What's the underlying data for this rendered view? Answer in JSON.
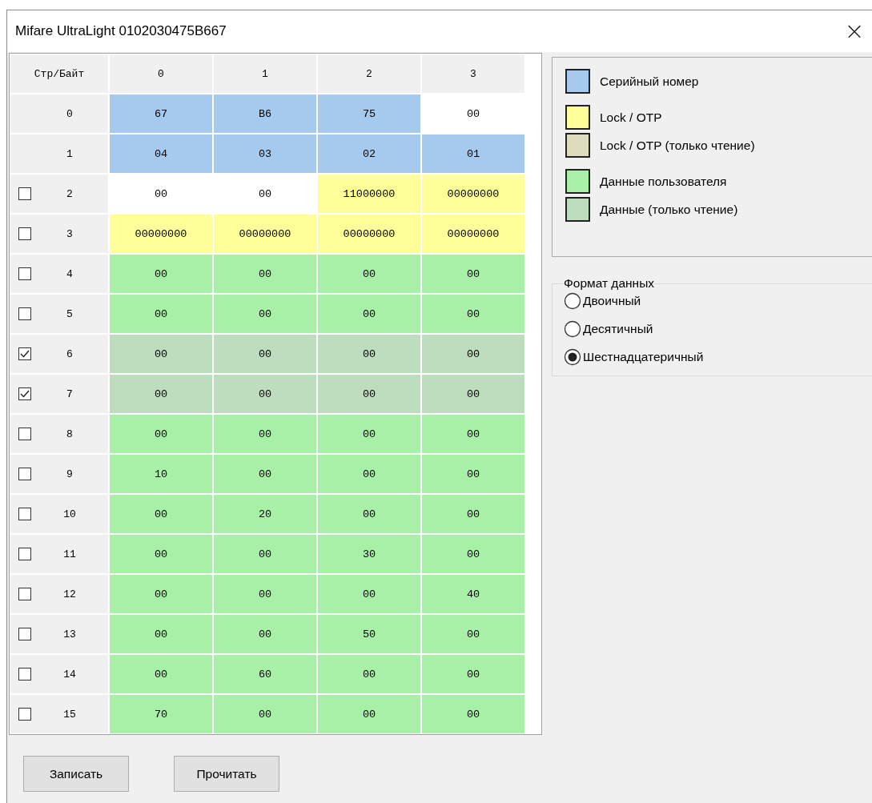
{
  "window": {
    "title": "Mifare UltraLight 0102030475B667",
    "close": "×"
  },
  "table": {
    "corner": "Стр/Байт",
    "columns": [
      "0",
      "1",
      "2",
      "3"
    ],
    "rows": [
      {
        "page": "0",
        "cells": [
          {
            "value": "67",
            "kind": "serial"
          },
          {
            "value": "B6",
            "kind": "serial"
          },
          {
            "value": "75",
            "kind": "serial"
          },
          {
            "value": "00",
            "kind": "plain"
          }
        ]
      },
      {
        "page": "1",
        "cells": [
          {
            "value": "04",
            "kind": "serial"
          },
          {
            "value": "03",
            "kind": "serial"
          },
          {
            "value": "02",
            "kind": "serial"
          },
          {
            "value": "01",
            "kind": "serial"
          }
        ]
      },
      {
        "page": "2",
        "checked": false,
        "cells": [
          {
            "value": "00",
            "kind": "plain"
          },
          {
            "value": "00",
            "kind": "plain"
          },
          {
            "value": "11000000",
            "kind": "lock"
          },
          {
            "value": "00000000",
            "kind": "lock"
          }
        ]
      },
      {
        "page": "3",
        "checked": false,
        "cells": [
          {
            "value": "00000000",
            "kind": "lock"
          },
          {
            "value": "00000000",
            "kind": "lock"
          },
          {
            "value": "00000000",
            "kind": "lock"
          },
          {
            "value": "00000000",
            "kind": "lock"
          }
        ]
      },
      {
        "page": "4",
        "checked": false,
        "cells": [
          {
            "value": "00",
            "kind": "data"
          },
          {
            "value": "00",
            "kind": "data"
          },
          {
            "value": "00",
            "kind": "data"
          },
          {
            "value": "00",
            "kind": "data"
          }
        ]
      },
      {
        "page": "5",
        "checked": false,
        "cells": [
          {
            "value": "00",
            "kind": "data"
          },
          {
            "value": "00",
            "kind": "data"
          },
          {
            "value": "00",
            "kind": "data"
          },
          {
            "value": "00",
            "kind": "data"
          }
        ]
      },
      {
        "page": "6",
        "checked": true,
        "cells": [
          {
            "value": "00",
            "kind": "data_ro"
          },
          {
            "value": "00",
            "kind": "data_ro"
          },
          {
            "value": "00",
            "kind": "data_ro"
          },
          {
            "value": "00",
            "kind": "data_ro"
          }
        ]
      },
      {
        "page": "7",
        "checked": true,
        "cells": [
          {
            "value": "00",
            "kind": "data_ro"
          },
          {
            "value": "00",
            "kind": "data_ro"
          },
          {
            "value": "00",
            "kind": "data_ro"
          },
          {
            "value": "00",
            "kind": "data_ro"
          }
        ]
      },
      {
        "page": "8",
        "checked": false,
        "cells": [
          {
            "value": "00",
            "kind": "data"
          },
          {
            "value": "00",
            "kind": "data"
          },
          {
            "value": "00",
            "kind": "data"
          },
          {
            "value": "00",
            "kind": "data"
          }
        ]
      },
      {
        "page": "9",
        "checked": false,
        "cells": [
          {
            "value": "10",
            "kind": "data"
          },
          {
            "value": "00",
            "kind": "data"
          },
          {
            "value": "00",
            "kind": "data"
          },
          {
            "value": "00",
            "kind": "data"
          }
        ]
      },
      {
        "page": "10",
        "checked": false,
        "cells": [
          {
            "value": "00",
            "kind": "data"
          },
          {
            "value": "20",
            "kind": "data"
          },
          {
            "value": "00",
            "kind": "data"
          },
          {
            "value": "00",
            "kind": "data"
          }
        ]
      },
      {
        "page": "11",
        "checked": false,
        "cells": [
          {
            "value": "00",
            "kind": "data"
          },
          {
            "value": "00",
            "kind": "data"
          },
          {
            "value": "30",
            "kind": "data"
          },
          {
            "value": "00",
            "kind": "data"
          }
        ]
      },
      {
        "page": "12",
        "checked": false,
        "cells": [
          {
            "value": "00",
            "kind": "data"
          },
          {
            "value": "00",
            "kind": "data"
          },
          {
            "value": "00",
            "kind": "data"
          },
          {
            "value": "40",
            "kind": "data"
          }
        ]
      },
      {
        "page": "13",
        "checked": false,
        "cells": [
          {
            "value": "00",
            "kind": "data"
          },
          {
            "value": "00",
            "kind": "data"
          },
          {
            "value": "50",
            "kind": "data"
          },
          {
            "value": "00",
            "kind": "data"
          }
        ]
      },
      {
        "page": "14",
        "checked": false,
        "cells": [
          {
            "value": "00",
            "kind": "data"
          },
          {
            "value": "60",
            "kind": "data"
          },
          {
            "value": "00",
            "kind": "data"
          },
          {
            "value": "00",
            "kind": "data"
          }
        ]
      },
      {
        "page": "15",
        "checked": false,
        "cells": [
          {
            "value": "70",
            "kind": "data"
          },
          {
            "value": "00",
            "kind": "data"
          },
          {
            "value": "00",
            "kind": "data"
          },
          {
            "value": "00",
            "kind": "data"
          }
        ]
      }
    ]
  },
  "legend": [
    {
      "items": [
        {
          "kind": "serial",
          "label": "Серийный номер",
          "color": "#a6c9ee"
        }
      ]
    },
    {
      "items": [
        {
          "kind": "lock",
          "label": "Lock / OTP",
          "color": "#ffff99"
        },
        {
          "kind": "lock_ro",
          "label": "Lock / OTP (только чтение)",
          "color": "#dedcbe"
        }
      ]
    },
    {
      "items": [
        {
          "kind": "data",
          "label": "Данные пользователя",
          "color": "#a8f0a8"
        },
        {
          "kind": "data_ro",
          "label": "Данные (только чтение)",
          "color": "#bedcbe"
        }
      ]
    }
  ],
  "format": {
    "title": "Формат данных",
    "options": [
      {
        "label": "Двоичный",
        "selected": false
      },
      {
        "label": "Десятичный",
        "selected": false
      },
      {
        "label": "Шестнадцатеричный",
        "selected": true
      }
    ]
  },
  "buttons": [
    "Записать",
    "Прочитать"
  ]
}
